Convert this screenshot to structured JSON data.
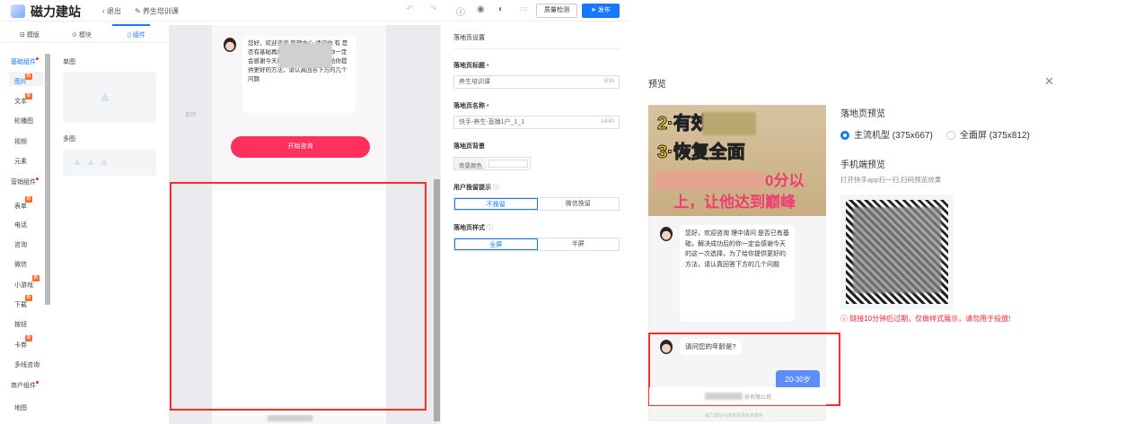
{
  "topbar": {
    "logo": "磁力建站",
    "back": "退出",
    "page_name": "养生培训课",
    "quality_check": "质量检测",
    "publish": "发布"
  },
  "tabs": [
    {
      "label": "模版"
    },
    {
      "label": "模块"
    },
    {
      "label": "组件"
    }
  ],
  "nav": {
    "cat_basic": "基础组件",
    "basic": [
      "图片",
      "文本",
      "轮播图",
      "视频",
      "元素"
    ],
    "cat_marketing": "营销组件",
    "marketing": [
      "表单",
      "电话",
      "咨询",
      "微信",
      "小游戏",
      "下载",
      "按钮",
      "卡券",
      "多线咨询"
    ],
    "cat_business": "商户组件",
    "business": [
      "地图"
    ],
    "badge": "新"
  },
  "components": {
    "single": "单图",
    "multi": "多图"
  },
  "canvas": {
    "chat_intro": "您好，欢迎咨询 管理中心 请问你 有 是否有基础再报名，解决成功后的你一定会感谢今天的这一次选择，为了给你提供更好的方法，请认真回答下方的几个问题",
    "cta": "开始咨询",
    "side_label": "百开"
  },
  "settings": {
    "title": "落地页设置",
    "page_title_label": "落地页标题",
    "page_title_value": "养生培训课",
    "page_title_count": "5/30",
    "page_name_label": "落地页名称",
    "page_name_value": "快手-养生-直播1户_1_1",
    "page_name_count": "14/40",
    "bg_label": "落地页背景",
    "bg_color": "背景颜色",
    "retain_label": "用户挽留提示",
    "retain_opts": [
      "不挽留",
      "微信挽留"
    ],
    "style_label": "落地页样式",
    "style_opts": [
      "全屏",
      "半屏"
    ]
  },
  "preview": {
    "title": "预览",
    "banner_lines": [
      "2·有效",
      "3·恢复全面",
      "0分以",
      "上，让他达到巅峰"
    ],
    "intro": "您好，欢迎咨询 理中请问 是否已有基础，解决成功后的你一定会感谢今天的这一次选择，为了给你提供更好的方法，请认真回答下方的几个问题",
    "question": "请问您的年龄是?",
    "answer": "20-30岁",
    "company": "技有限公司",
    "footer": "磁力建站为商家提供技术服务",
    "lp_preview": "落地页预览",
    "opt1": "主流机型 (375x667)",
    "opt2": "全面屏 (375x812)",
    "mobile_preview": "手机端预览",
    "scan_tip": "打开快手app扫一扫,扫码预览效果",
    "warning": "链接10分钟后过期，仅做样式展示，请勿用于投放!"
  }
}
